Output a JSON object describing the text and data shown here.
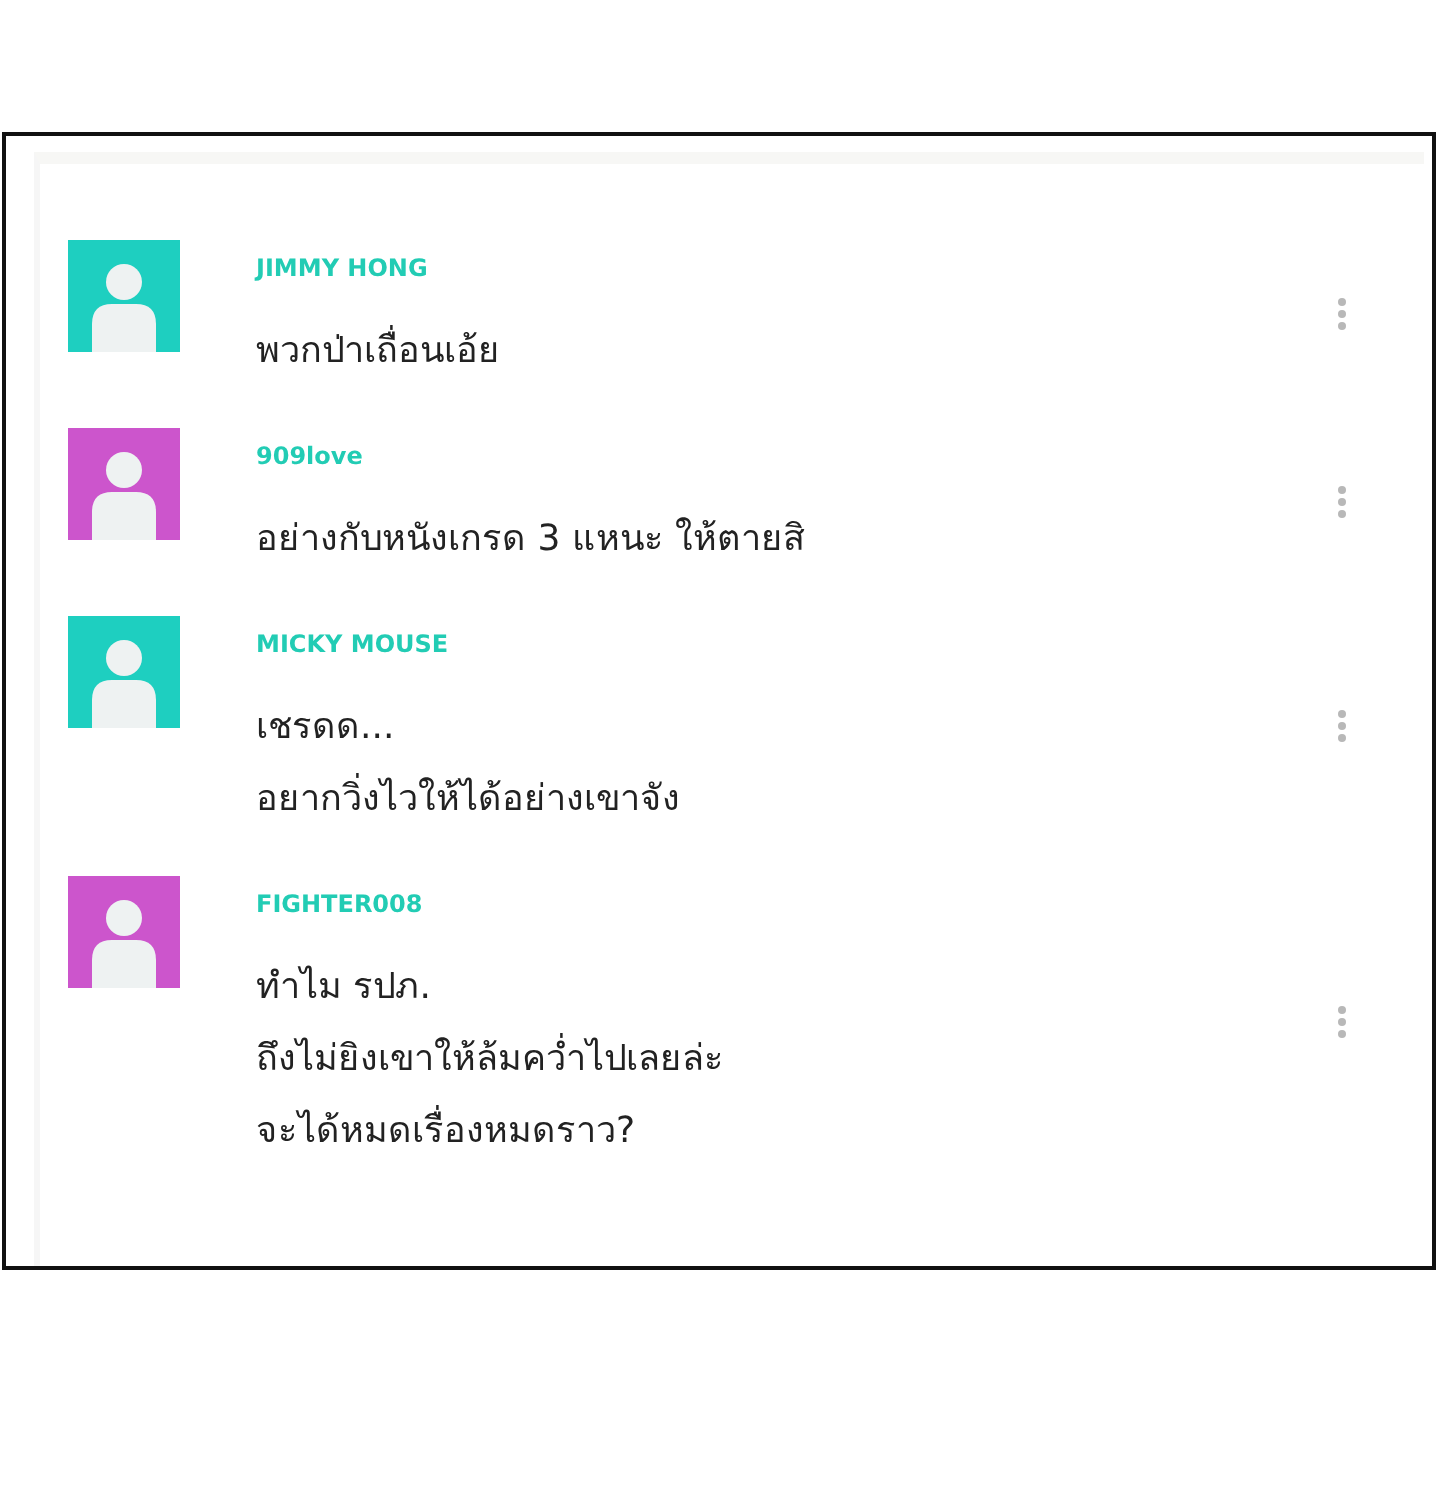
{
  "comments": [
    {
      "author": "JIMMY HONG",
      "color": "#1ecfc0",
      "lines": [
        "พวกป่าเถื่อนเอ้ย"
      ]
    },
    {
      "author": "909love",
      "color": "#cc55cc",
      "lines": [
        "อย่างกับหนังเกรด 3 แหนะ ให้ตายสิ"
      ]
    },
    {
      "author": "MICKY MOUSE",
      "color": "#1ecfc0",
      "lines": [
        "เชรดด...",
        "อยากวิ่งไวให้ได้อย่างเขาจัง"
      ]
    },
    {
      "author": "FIGHTER008",
      "color": "#cc55cc",
      "lines": [
        "ทำไม รปภ.",
        "ถึงไม่ยิงเขาให้ล้มคว่ำไปเลยล่ะ",
        "จะได้หมดเรื่องหมดราว?"
      ]
    }
  ]
}
